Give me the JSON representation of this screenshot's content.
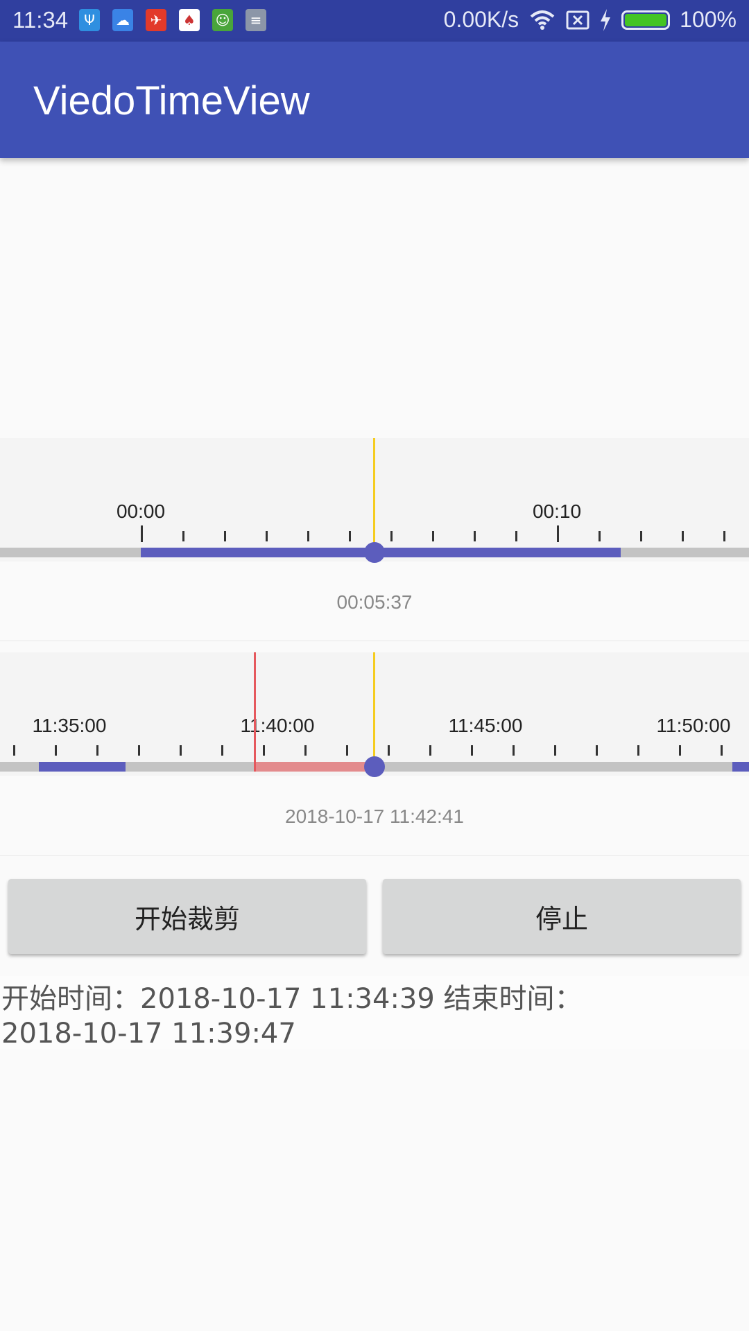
{
  "status_bar": {
    "time": "11:34",
    "net_speed": "0.00K/s",
    "battery": "100%",
    "icons": [
      "usb-icon",
      "cloud-icon",
      "app-red-icon",
      "card-icon",
      "frog-icon",
      "notes-icon"
    ]
  },
  "app_bar": {
    "title": "ViedoTimeView"
  },
  "timeline1": {
    "labels": [
      "00:00",
      "00:10"
    ],
    "current": "00:05:37",
    "colors": {
      "selection": "#5c5dbd",
      "track": "#c3c3c3",
      "cursor": "#f5cc1f"
    }
  },
  "timeline2": {
    "labels": [
      "11:35:00",
      "11:40:00",
      "11:45:00",
      "11:50:00"
    ],
    "current": "2018-10-17 11:42:41",
    "colors": {
      "recorded": "#5c5dbd",
      "clip": "#e38b8d",
      "clip_start": "#e5585d",
      "cursor": "#f5cc1f"
    }
  },
  "buttons": {
    "start_clip": "开始裁剪",
    "stop": "停止"
  },
  "result": {
    "line1": "开始时间：2018-10-17 11:34:39 结束时间：",
    "line2": "2018-10-17 11:39:47"
  }
}
